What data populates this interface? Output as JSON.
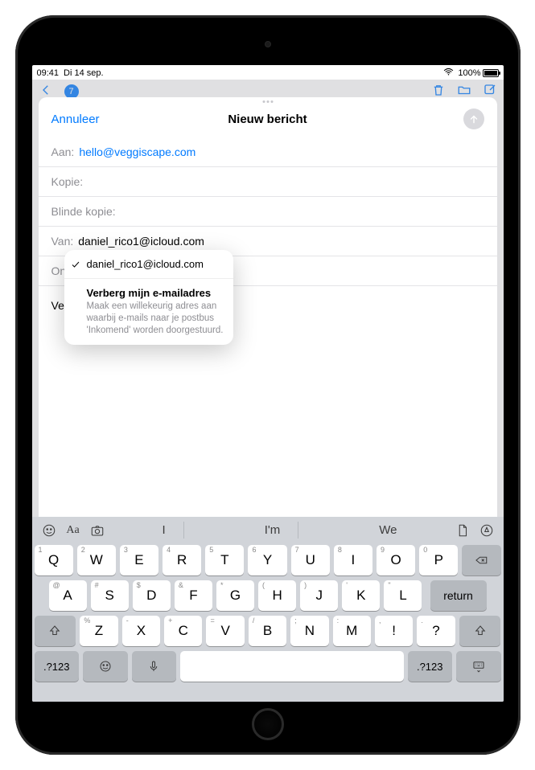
{
  "status": {
    "time": "09:41",
    "date": "Di 14 sep.",
    "battery": "100%"
  },
  "compose": {
    "cancel": "Annuleer",
    "title": "Nieuw bericht",
    "fields": {
      "to_label": "Aan:",
      "to_value": "hello@veggiscape.com",
      "cc_label": "Kopie:",
      "bcc_label": "Blinde kopie:",
      "from_label": "Van:",
      "from_value": "daniel_rico1@icloud.com",
      "subject_label": "Onde",
      "body_partial": "Vers"
    }
  },
  "from_popover": {
    "selected": "daniel_rico1@icloud.com",
    "hide_title": "Verberg mijn e-mailadres",
    "hide_desc": "Maak een willekeurig adres aan waarbij e-mails naar je postbus 'Inkomend' worden doorgestuurd."
  },
  "keyboard": {
    "suggestions": [
      "I",
      "I'm",
      "We"
    ],
    "row1": [
      {
        "l": "Q",
        "h": "1"
      },
      {
        "l": "W",
        "h": "2"
      },
      {
        "l": "E",
        "h": "3"
      },
      {
        "l": "R",
        "h": "4"
      },
      {
        "l": "T",
        "h": "5"
      },
      {
        "l": "Y",
        "h": "6"
      },
      {
        "l": "U",
        "h": "7"
      },
      {
        "l": "I",
        "h": "8"
      },
      {
        "l": "O",
        "h": "9"
      },
      {
        "l": "P",
        "h": "0"
      }
    ],
    "row2": [
      {
        "l": "A",
        "h": "@"
      },
      {
        "l": "S",
        "h": "#"
      },
      {
        "l": "D",
        "h": "$"
      },
      {
        "l": "F",
        "h": "&"
      },
      {
        "l": "G",
        "h": "*"
      },
      {
        "l": "H",
        "h": "("
      },
      {
        "l": "J",
        "h": ")"
      },
      {
        "l": "K",
        "h": "'"
      },
      {
        "l": "L",
        "h": "\""
      }
    ],
    "row3": [
      {
        "l": "Z",
        "h": "%"
      },
      {
        "l": "X",
        "h": "-"
      },
      {
        "l": "C",
        "h": "+"
      },
      {
        "l": "V",
        "h": "="
      },
      {
        "l": "B",
        "h": "/"
      },
      {
        "l": "N",
        "h": ";"
      },
      {
        "l": "M",
        "h": ":"
      },
      {
        "l": "!",
        "h": ","
      },
      {
        "l": "?",
        "h": "."
      }
    ],
    "numkey": ".?123",
    "return": "return",
    "style_label": "Aa"
  }
}
